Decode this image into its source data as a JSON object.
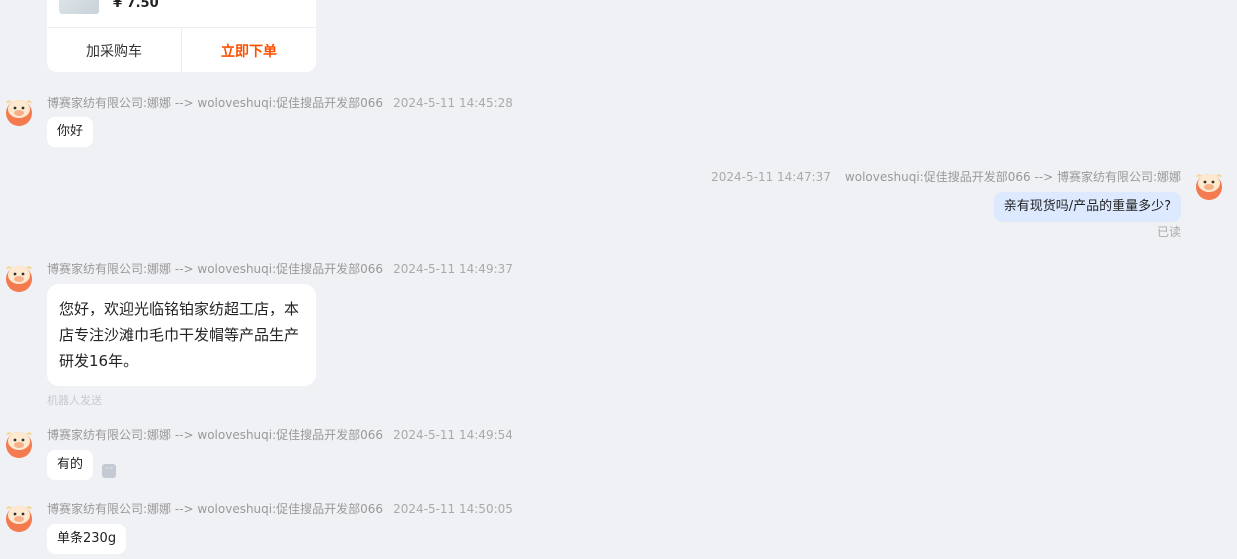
{
  "product_card": {
    "price": "¥ 7.50",
    "add_cart_label": "加采购车",
    "buy_now_label": "立即下单"
  },
  "messages": [
    {
      "sender": "博赛家纺有限公司:娜娜 --> woloveshuqi:促佳搜品开发部066",
      "time": "2024-5-11 14:45:28",
      "text": "你好"
    },
    {
      "sender": "woloveshuqi:促佳搜品开发部066 --> 博赛家纺有限公司:娜娜",
      "time": "2024-5-11 14:47:37",
      "text": "亲有现货吗/产品的重量多少?",
      "status": "已读"
    },
    {
      "sender": "博赛家纺有限公司:娜娜 --> woloveshuqi:促佳搜品开发部066",
      "time": "2024-5-11 14:49:37",
      "text": "您好，欢迎光临铭铂家纺超工店，本店专注沙滩巾毛巾干发帽等产品生产研发16年。",
      "note": "机器人发送"
    },
    {
      "sender": "博赛家纺有限公司:娜娜 --> woloveshuqi:促佳搜品开发部066",
      "time": "2024-5-11 14:49:54",
      "text": "有的"
    },
    {
      "sender": "博赛家纺有限公司:娜娜 --> woloveshuqi:促佳搜品开发部066",
      "time": "2024-5-11 14:50:05",
      "text": "单条230g"
    }
  ],
  "icons": {
    "avatar": "cow-avatar-icon",
    "more": "more-options-icon"
  },
  "colors": {
    "accent": "#ff5000",
    "my_bubble": "#dde9ff",
    "background": "#f0f1f5"
  }
}
